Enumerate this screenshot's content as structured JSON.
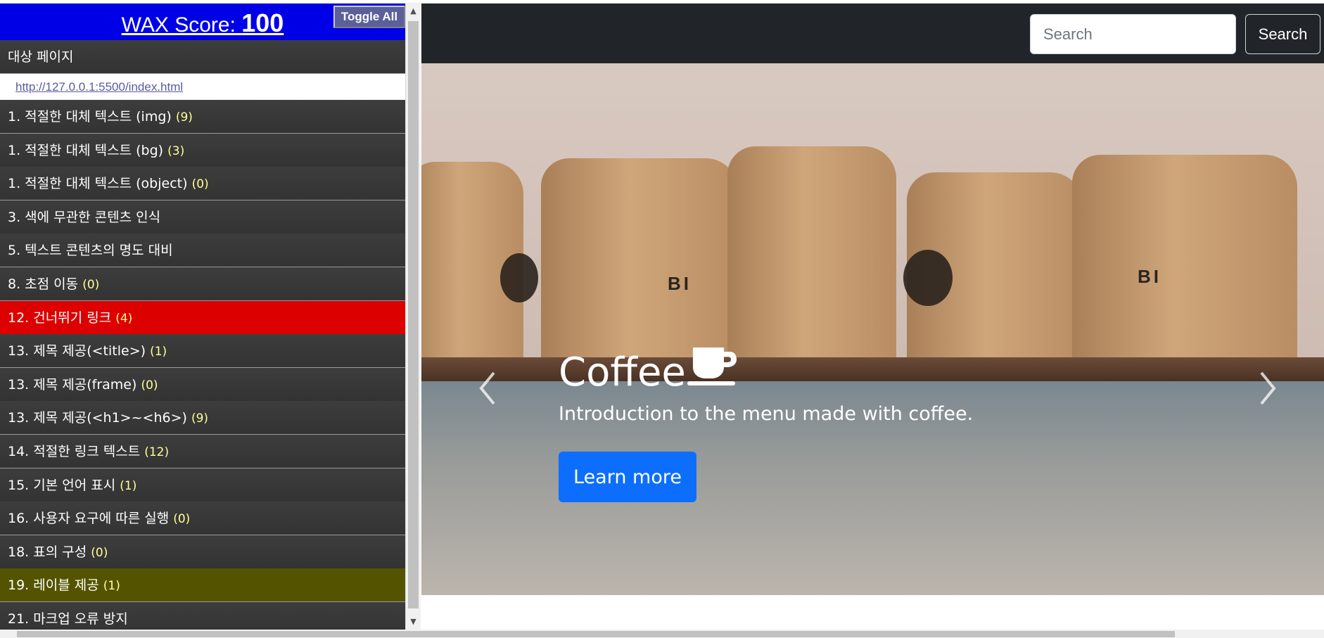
{
  "wax": {
    "score_label": "WAX Score:",
    "score_value": "100",
    "toggle_all": "Toggle All",
    "target_page_label": "대상 페이지",
    "target_url": "http://127.0.0.1:5500/index.html",
    "items": [
      {
        "label": "1. 적절한 대체 텍스트 (img)",
        "count": "(9)",
        "status": "normal"
      },
      {
        "label": "1. 적절한 대체 텍스트 (bg)",
        "count": "(3)",
        "status": "normal"
      },
      {
        "label": "1. 적절한 대체 텍스트 (object)",
        "count": "(0)",
        "status": "normal"
      },
      {
        "label": "3. 색에 무관한 콘텐츠 인식",
        "count": "",
        "status": "normal"
      },
      {
        "label": "5. 텍스트 콘텐츠의 명도 대비",
        "count": "",
        "status": "normal"
      },
      {
        "label": "8. 초점 이동",
        "count": "(0)",
        "status": "normal"
      },
      {
        "label": "12. 건너뛰기 링크",
        "count": "(4)",
        "status": "error"
      },
      {
        "label": "13. 제목 제공(<title>)",
        "count": "(1)",
        "status": "normal"
      },
      {
        "label": "13. 제목 제공(frame)",
        "count": "(0)",
        "status": "normal"
      },
      {
        "label": "13. 제목 제공(<h1>~<h6>)",
        "count": "(9)",
        "status": "normal"
      },
      {
        "label": "14. 적절한 링크 텍스트",
        "count": "(12)",
        "status": "normal"
      },
      {
        "label": "15. 기본 언어 표시",
        "count": "(1)",
        "status": "normal"
      },
      {
        "label": "16. 사용자 요구에 따른 실행",
        "count": "(0)",
        "status": "normal"
      },
      {
        "label": "18. 표의 구성",
        "count": "(0)",
        "status": "normal"
      },
      {
        "label": "19. 레이블 제공",
        "count": "(1)",
        "status": "warning"
      },
      {
        "label": "21. 마크업 오류 방지",
        "count": "",
        "status": "normal"
      }
    ],
    "colors": {
      "header": "#0000e6",
      "error": "#dd0000",
      "warning": "#545400",
      "count": "#ffff99"
    }
  },
  "navbar": {
    "search_placeholder": "Search",
    "search_button": "Search"
  },
  "carousel": {
    "title": "Coffee",
    "title_icon": "coffee-cup-icon",
    "caption": "Introduction to the menu made with coffee.",
    "button": "Learn more",
    "slide_count": 3,
    "active_slide": 1,
    "bag_text": "BI"
  },
  "colors": {
    "navbar": "#212529",
    "primary": "#0d6efd"
  }
}
